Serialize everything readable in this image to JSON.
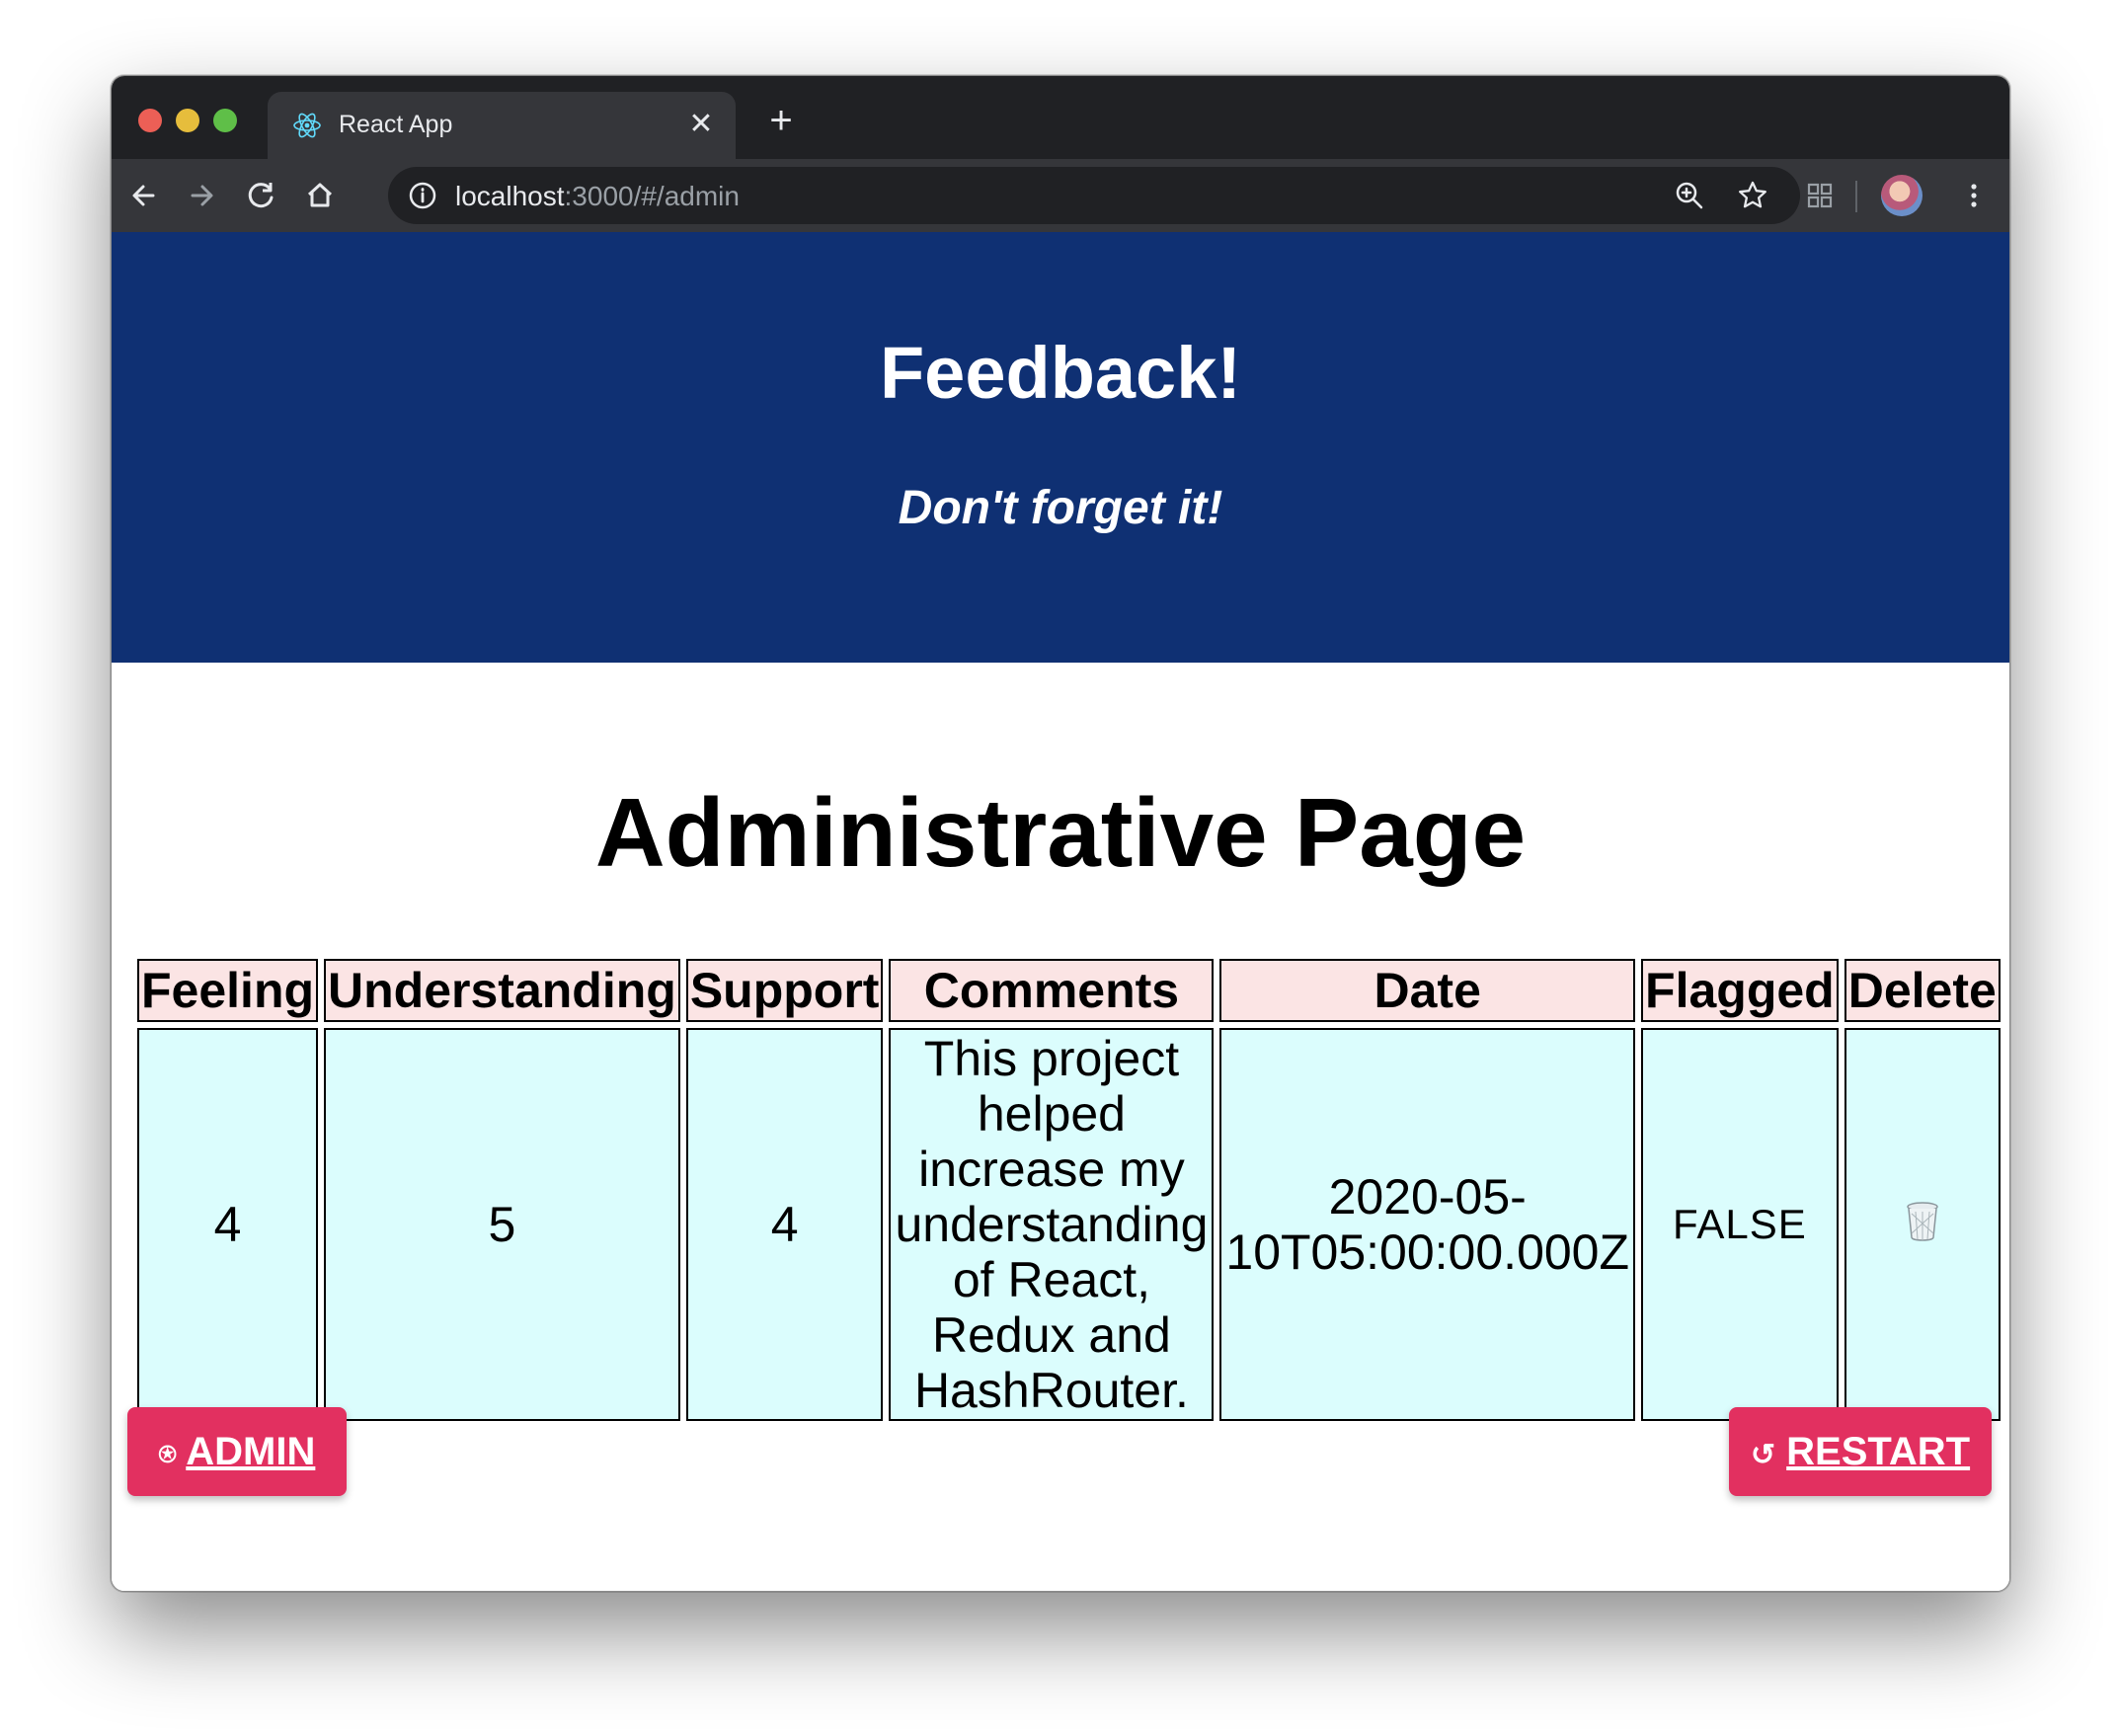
{
  "browser": {
    "tab_title": "React App",
    "url_host": "localhost",
    "url_rest": ":3000/#/admin",
    "icons": [
      "react-icon",
      "close-icon",
      "plus-icon",
      "back-icon",
      "forward-icon",
      "reload-icon",
      "home-icon",
      "info-icon",
      "zoom-icon",
      "star-icon",
      "extensions-icon",
      "avatar",
      "menu-icon"
    ]
  },
  "header": {
    "title": "Feedback!",
    "subtitle": "Don't forget it!"
  },
  "main": {
    "title": "Administrative Page",
    "table": {
      "columns": [
        "Feeling",
        "Understanding",
        "Support",
        "Comments",
        "Date",
        "Flagged",
        "Delete"
      ],
      "rows": [
        {
          "feeling": "4",
          "understanding": "5",
          "support": "4",
          "comments": "This project helped increase my understanding of React, Redux and HashRouter.",
          "date": "2020-05-10T05:00:00.000Z",
          "flagged": "FALSE",
          "delete_icon": "trash-icon"
        }
      ]
    }
  },
  "buttons": {
    "admin_label": "ADMIN",
    "admin_icon": "⍟",
    "restart_label": "RESTART",
    "restart_icon": "↺",
    "color": "#e23060"
  },
  "colors": {
    "header_bg": "#0f3073",
    "th_bg": "#fbe4e4",
    "td_bg": "#dbfdfd"
  }
}
